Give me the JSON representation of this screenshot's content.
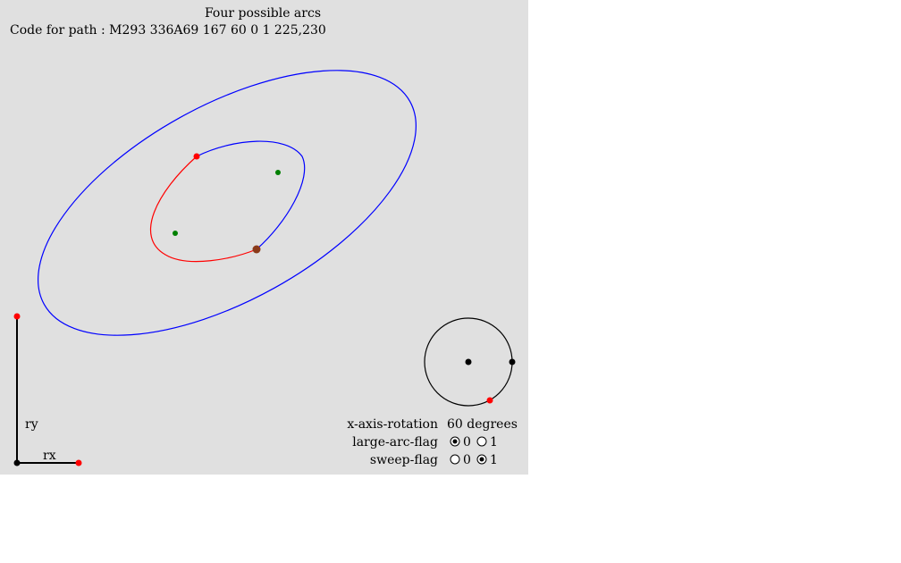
{
  "title": "Four possible arcs",
  "code_prefix": "Code for path : ",
  "code_path": "M293 336A69 167 60 0 1 225,230",
  "axis_labels": {
    "ry": "ry",
    "rx": "rx"
  },
  "controls": {
    "rotation_label": "x-axis-rotation",
    "rotation_value": "60 degrees",
    "large_arc_label": "large-arc-flag",
    "large_arc_options": [
      "0",
      "1"
    ],
    "large_arc_selected": "0",
    "sweep_label": "sweep-flag",
    "sweep_options": [
      "0",
      "1"
    ],
    "sweep_selected": "1"
  },
  "colors": {
    "background": "#e0e0e0",
    "ellipse_stroke": "#0000ff",
    "selected_arc": "#ff0000",
    "endpoint": "#ff0000",
    "center": "#008000",
    "handle": "#000000"
  }
}
